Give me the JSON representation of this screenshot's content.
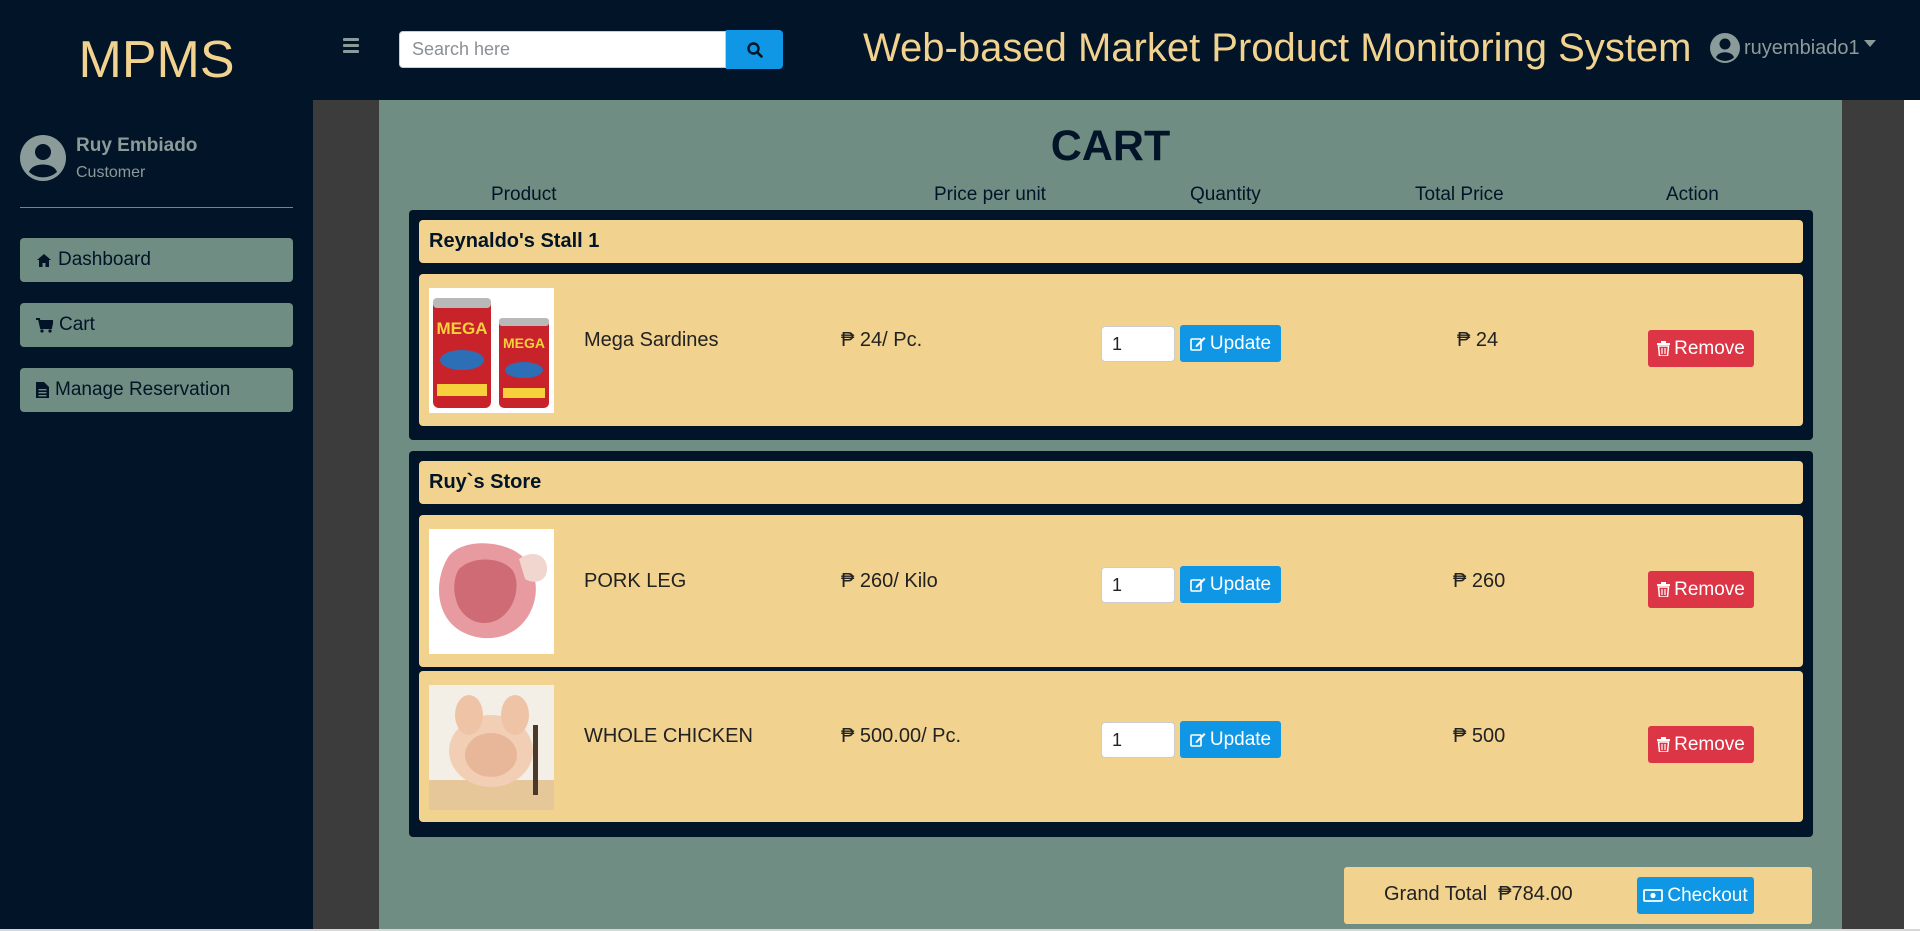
{
  "sidebar": {
    "brand": "MPMS",
    "user": {
      "name": "Ruy Embiado",
      "role": "Customer"
    },
    "items": [
      {
        "label": "Dashboard",
        "icon": "home-icon"
      },
      {
        "label": "Cart",
        "icon": "cart-icon"
      },
      {
        "label": "Manage Reservation",
        "icon": "document-icon"
      }
    ]
  },
  "topbar": {
    "search_placeholder": "Search here",
    "title": "Web-based Market Product Monitoring System",
    "account": "ruyembiado1"
  },
  "cart": {
    "title": "CART",
    "headers": {
      "product": "Product",
      "price": "Price per unit",
      "quantity": "Quantity",
      "total": "Total Price",
      "action": "Action"
    },
    "update_label": "Update",
    "remove_label": "Remove",
    "stores": [
      {
        "name": "Reynaldo's Stall 1",
        "items": [
          {
            "name": "Mega Sardines",
            "price": "₱ 24/ Pc.",
            "qty": "1",
            "total": "₱ 24",
            "image": "sardines-can"
          }
        ]
      },
      {
        "name": "Ruy`s Store",
        "items": [
          {
            "name": "PORK LEG",
            "price": "₱ 260/ Kilo",
            "qty": "1",
            "total": "₱ 260",
            "image": "pork-leg"
          },
          {
            "name": "WHOLE CHICKEN",
            "price": "₱ 500.00/ Pc.",
            "qty": "1",
            "total": "₱ 500",
            "image": "whole-chicken"
          }
        ]
      }
    ],
    "grand_total_label": "Grand Total",
    "grand_total_value": "₱784.00",
    "checkout_label": "Checkout"
  },
  "colors": {
    "navy": "#021427",
    "gold": "#f1d28e",
    "sage": "#6f8d82",
    "blue": "#0f97e6",
    "red": "#dc3545"
  }
}
